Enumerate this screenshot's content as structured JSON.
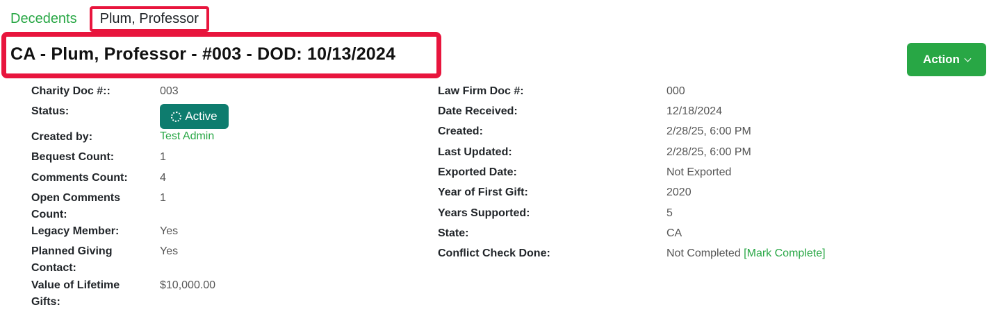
{
  "breadcrumb": {
    "parent": "Decedents",
    "current": "Plum, Professor"
  },
  "page": {
    "title": "CA - Plum, Professor - #003 - DOD: 10/13/2024"
  },
  "actions": {
    "action_label": "Action"
  },
  "left_fields": {
    "charity_doc": {
      "label": "Charity Doc #::",
      "value": "003"
    },
    "status": {
      "label": "Status:",
      "value": "Active"
    },
    "created_by": {
      "label": "Created by:",
      "value": "Test Admin"
    },
    "bequest_count": {
      "label": "Bequest Count:",
      "value": "1"
    },
    "comments_count": {
      "label": "Comments Count:",
      "value": "4"
    },
    "open_comments": {
      "label_line1": "Open Comments",
      "label_line2": "Count:",
      "value": "1"
    },
    "legacy_member": {
      "label": "Legacy Member:",
      "value": "Yes"
    },
    "planned_giving": {
      "label_line1": "Planned Giving",
      "label_line2": "Contact:",
      "value": "Yes"
    },
    "lifetime_gifts": {
      "label_line1": "Value of Lifetime",
      "label_line2": "Gifts:",
      "value": "$10,000.00"
    }
  },
  "right_fields": {
    "law_firm_doc": {
      "label": "Law Firm Doc #:",
      "value": "000"
    },
    "date_received": {
      "label": "Date Received:",
      "value": "12/18/2024"
    },
    "created": {
      "label": "Created:",
      "value": "2/28/25, 6:00 PM"
    },
    "last_updated": {
      "label": "Last Updated:",
      "value": "2/28/25, 6:00 PM"
    },
    "exported_date": {
      "label": "Exported Date:",
      "value": "Not Exported"
    },
    "first_gift_year": {
      "label": "Year of First Gift:",
      "value": "2020"
    },
    "years_supported": {
      "label": "Years Supported:",
      "value": "5"
    },
    "state": {
      "label": "State:",
      "value": "CA"
    },
    "conflict_check": {
      "label": "Conflict Check Done:",
      "value": "Not Completed",
      "action": "[Mark Complete]"
    }
  },
  "colors": {
    "accent_green": "#28a745",
    "status_teal": "#0e7c6e",
    "highlight_red": "#e8153d"
  }
}
